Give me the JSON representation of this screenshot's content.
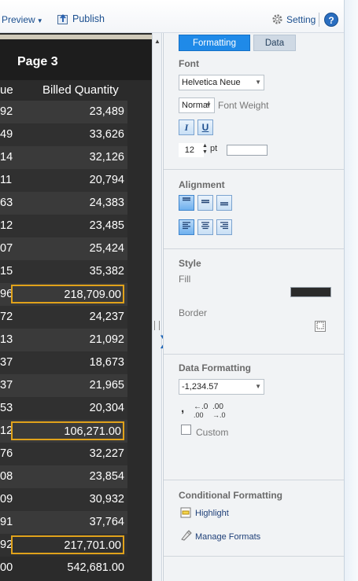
{
  "toolbar": {
    "preview_label": "Preview",
    "publish_label": "Publish",
    "setting_label": "Setting",
    "help_label": "?"
  },
  "report": {
    "page_title": "Page 3",
    "col1_header_fragment": "ue",
    "col2_header": "Billed Quantity",
    "rows": [
      {
        "c1": "92",
        "c2": "23,489",
        "hl": false
      },
      {
        "c1": "49",
        "c2": "33,626",
        "hl": false
      },
      {
        "c1": "14",
        "c2": "32,126",
        "hl": false
      },
      {
        "c1": "11",
        "c2": "20,794",
        "hl": false
      },
      {
        "c1": "63",
        "c2": "24,383",
        "hl": false
      },
      {
        "c1": "12",
        "c2": "23,485",
        "hl": false
      },
      {
        "c1": "07",
        "c2": "25,424",
        "hl": false
      },
      {
        "c1": "15",
        "c2": "35,382",
        "hl": false
      },
      {
        "c1": "96",
        "c2": "218,709.00",
        "hl": true
      },
      {
        "c1": "72",
        "c2": "24,237",
        "hl": false
      },
      {
        "c1": "13",
        "c2": "21,092",
        "hl": false
      },
      {
        "c1": "37",
        "c2": "18,673",
        "hl": false
      },
      {
        "c1": "37",
        "c2": "21,965",
        "hl": false
      },
      {
        "c1": "53",
        "c2": "20,304",
        "hl": false
      },
      {
        "c1": "12",
        "c2": "106,271.00",
        "hl": true
      },
      {
        "c1": "76",
        "c2": "32,227",
        "hl": false
      },
      {
        "c1": "08",
        "c2": "23,854",
        "hl": false
      },
      {
        "c1": "09",
        "c2": "30,932",
        "hl": false
      },
      {
        "c1": "91",
        "c2": "37,764",
        "hl": false
      },
      {
        "c1": "92",
        "c2": "217,701.00",
        "hl": true
      },
      {
        "c1": "00",
        "c2": "542,681.00",
        "hl": false
      }
    ],
    "highlight_color": "#e0a21b"
  },
  "panel": {
    "tabs": {
      "formatting": "Formatting",
      "data": "Data"
    },
    "font": {
      "title": "Font",
      "family": "Helvetica Neue",
      "weight": "Normal",
      "weight_label": "Font Weight",
      "italic": "I",
      "underline": "U",
      "size": "12",
      "size_unit": "pt"
    },
    "alignment": {
      "title": "Alignment"
    },
    "style": {
      "title": "Style",
      "fill_label": "Fill",
      "border_label": "Border",
      "fill_color": "#2b2b2b"
    },
    "data_formatting": {
      "title": "Data Formatting",
      "format": "-1,234.57",
      "custom_label": "Custom"
    },
    "conditional": {
      "title": "Conditional Formatting",
      "highlight_link": "Highlight",
      "manage_link": "Manage Formats"
    }
  }
}
